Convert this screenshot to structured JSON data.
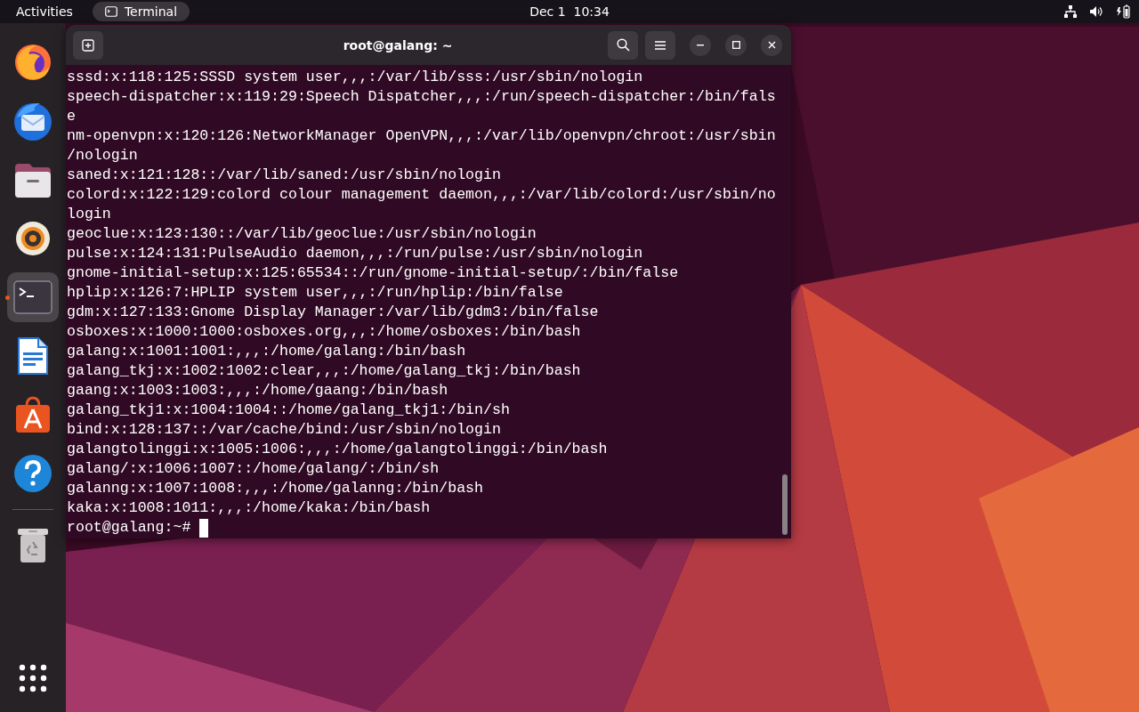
{
  "top_bar": {
    "activities": "Activities",
    "app_menu": "Terminal",
    "clock": "Dec 1  10:34"
  },
  "dock": {
    "apps": [
      {
        "kind": "firefox",
        "running": false,
        "selected": false
      },
      {
        "kind": "thunderbird",
        "running": false,
        "selected": false
      },
      {
        "kind": "files",
        "running": false,
        "selected": false
      },
      {
        "kind": "rhythmbox",
        "running": false,
        "selected": false
      },
      {
        "kind": "terminal",
        "running": true,
        "selected": true
      },
      {
        "kind": "writer",
        "running": false,
        "selected": false
      },
      {
        "kind": "appcenter",
        "running": false,
        "selected": false
      },
      {
        "kind": "help",
        "running": false,
        "selected": false
      },
      {
        "kind": "trash",
        "running": false,
        "selected": false
      }
    ]
  },
  "terminal": {
    "title": "root@galang: ~",
    "lines": [
      "sssd:x:118:125:SSSD system user,,,:/var/lib/sss:/usr/sbin/nologin",
      "speech-dispatcher:x:119:29:Speech Dispatcher,,,:/run/speech-dispatcher:/bin/fals",
      "e",
      "nm-openvpn:x:120:126:NetworkManager OpenVPN,,,:/var/lib/openvpn/chroot:/usr/sbin",
      "/nologin",
      "saned:x:121:128::/var/lib/saned:/usr/sbin/nologin",
      "colord:x:122:129:colord colour management daemon,,,:/var/lib/colord:/usr/sbin/no",
      "login",
      "geoclue:x:123:130::/var/lib/geoclue:/usr/sbin/nologin",
      "pulse:x:124:131:PulseAudio daemon,,,:/run/pulse:/usr/sbin/nologin",
      "gnome-initial-setup:x:125:65534::/run/gnome-initial-setup/:/bin/false",
      "hplip:x:126:7:HPLIP system user,,,:/run/hplip:/bin/false",
      "gdm:x:127:133:Gnome Display Manager:/var/lib/gdm3:/bin/false",
      "osboxes:x:1000:1000:osboxes.org,,,:/home/osboxes:/bin/bash",
      "galang:x:1001:1001:,,,:/home/galang:/bin/bash",
      "galang_tkj:x:1002:1002:clear,,,:/home/galang_tkj:/bin/bash",
      "gaang:x:1003:1003:,,,:/home/gaang:/bin/bash",
      "galang_tkj1:x:1004:1004::/home/galang_tkj1:/bin/sh",
      "bind:x:128:137::/var/cache/bind:/usr/sbin/nologin",
      "galangtolinggi:x:1005:1006:,,,:/home/galangtolinggi:/bin/bash",
      "galang/:x:1006:1007::/home/galang/:/bin/sh",
      "galanng:x:1007:1008:,,,:/home/galanng:/bin/bash",
      "kaka:x:1008:1011:,,,:/home/kaka:/bin/bash"
    ],
    "prompt": "root@galang:~#"
  }
}
